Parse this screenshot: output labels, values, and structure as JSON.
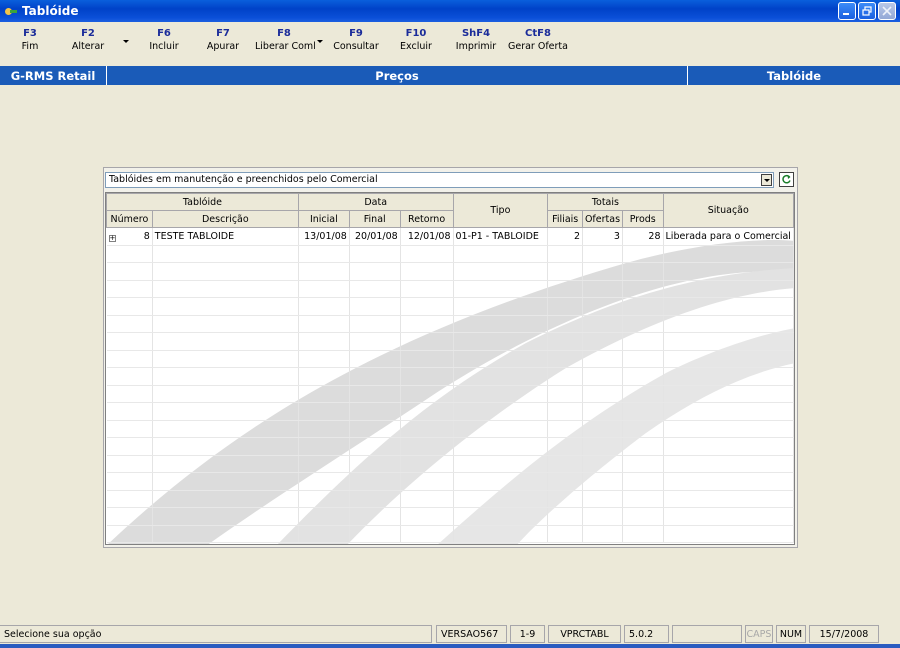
{
  "window": {
    "title": "Tablóide"
  },
  "toolbar": [
    {
      "key": "F3",
      "label": "Fim"
    },
    {
      "key": "F2",
      "label": "Alterar"
    },
    {
      "key": "F6",
      "label": "Incluir"
    },
    {
      "key": "F7",
      "label": "Apurar"
    },
    {
      "key": "F8",
      "label": "Liberar Coml"
    },
    {
      "key": "F9",
      "label": "Consultar"
    },
    {
      "key": "F10",
      "label": "Excluir"
    },
    {
      "key": "ShF4",
      "label": "Imprimir"
    },
    {
      "key": "CtF8",
      "label": "Gerar Oferta"
    }
  ],
  "header": {
    "left": "G-RMS Retail",
    "center": "Preços",
    "right": "Tablóide"
  },
  "filter": {
    "selected": "Tablóides em manutenção e preenchidos pelo Comercial"
  },
  "grid": {
    "groups": {
      "tabloide": "Tablóide",
      "data": "Data",
      "tipo": "Tipo",
      "totais": "Totais",
      "situacao": "Situação"
    },
    "columns": {
      "numero": "Número",
      "descricao": "Descrição",
      "inicial": "Inicial",
      "final": "Final",
      "retorno": "Retorno",
      "filiais": "Filiais",
      "ofertas": "Ofertas",
      "prods": "Prods"
    },
    "rows": [
      {
        "expand": "+",
        "numero": "8",
        "descricao": "TESTE TABLOIDE",
        "inicial": "13/01/08",
        "final": "20/01/08",
        "retorno": "12/01/08",
        "tipo": "01-P1 - TABLOIDE",
        "filiais": "2",
        "ofertas": "3",
        "prods": "28",
        "situacao": "Liberada para o Comercial"
      }
    ]
  },
  "status": {
    "message": "Selecione sua opção",
    "version": "VERSAO567",
    "page": "1-9",
    "program": "VPRCTABL",
    "release": "5.0.2",
    "caps": "CAPS",
    "num": "NUM",
    "date": "15/7/2008"
  }
}
